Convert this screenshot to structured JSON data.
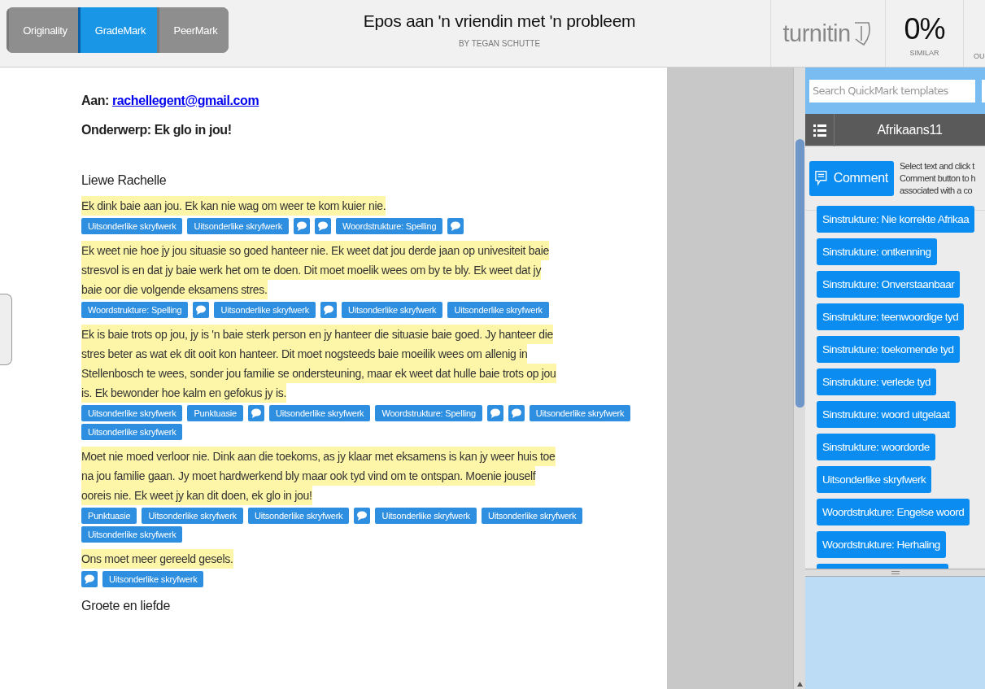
{
  "tabs": [
    {
      "label": "Originality",
      "selected": false
    },
    {
      "label": "GradeMark",
      "selected": true
    },
    {
      "label": "PeerMark",
      "selected": false
    }
  ],
  "paper": {
    "title": "Epos aan 'n vriendin met 'n probleem",
    "author": "BY TEGAN SCHUTTE"
  },
  "brand": "turnitin",
  "similarity": {
    "value": "0%",
    "label": "SIMILAR",
    "next_label": "OU"
  },
  "document": {
    "to_label": "Aan:",
    "to_email": "rachellegent@gmail.com",
    "subject": "Onderwerp: Ek glo in jou!",
    "greeting": "Liewe Rachelle",
    "paragraphs": [
      {
        "lines": [
          "Ek dink baie aan jou. Ek kan nie wag om weer te kom kuier nie."
        ],
        "marks": [
          {
            "kind": "label",
            "text": "Uitsonderlike skryfwerk"
          },
          {
            "kind": "label",
            "text": "Uitsonderlike skryfwerk"
          },
          {
            "kind": "comment"
          },
          {
            "kind": "comment"
          },
          {
            "kind": "label",
            "text": "Woordstrukture: Spelling"
          },
          {
            "kind": "comment"
          }
        ]
      },
      {
        "lines": [
          "Ek weet nie hoe jy jou situasie so goed hanteer nie. Ek weet dat jou derde jaan op univesiteit baie",
          "stresvol is en dat jy baie werk het om te doen. Dit moet moelik wees om by te bly. Ek weet dat jy",
          "baie oor die volgende eksamens stres."
        ],
        "marks": [
          {
            "kind": "label",
            "text": "Woordstrukture: Spelling"
          },
          {
            "kind": "comment"
          },
          {
            "kind": "label",
            "text": "Uitsonderlike skryfwerk"
          },
          {
            "kind": "comment"
          },
          {
            "kind": "label",
            "text": "Uitsonderlike skryfwerk"
          },
          {
            "kind": "label",
            "text": "Uitsonderlike skryfwerk"
          }
        ]
      },
      {
        "lines": [
          "Ek is baie trots op jou, jy is 'n baie sterk person en jy hanteer die situasie baie goed. Jy hanteer die",
          "stres beter as wat ek dit ooit kon hanteer. Dit moet nogsteeds baie moeilik wees om allenig in",
          "Stellenbosch te wees, sonder jou familie se ondersteuning, maar ek weet dat hulle baie trots op jou",
          "is. Ek bewonder hoe kalm en gefokus jy is."
        ],
        "marks": [
          {
            "kind": "label",
            "text": "Uitsonderlike skryfwerk"
          },
          {
            "kind": "label",
            "text": "Punktuasie"
          },
          {
            "kind": "comment"
          },
          {
            "kind": "label",
            "text": "Uitsonderlike skryfwerk"
          },
          {
            "kind": "label",
            "text": "Woordstrukture: Spelling"
          },
          {
            "kind": "comment"
          },
          {
            "kind": "comment"
          },
          {
            "kind": "label",
            "text": "Uitsonderlike skryfwerk"
          },
          {
            "kind": "label",
            "text": "Uitsonderlike skryfwerk"
          }
        ]
      },
      {
        "lines": [
          "Moet nie moed verloor nie. Dink aan die toekoms, as jy klaar met eksamens is kan jy weer huis toe",
          "na jou familie gaan. Jy moet hardwerkend bly maar ook tyd vind om te ontspan. Moenie jouself",
          "ooreis nie. Ek weet jy kan dit doen, ek glo in jou!"
        ],
        "marks": [
          {
            "kind": "label",
            "text": "Punktuasie"
          },
          {
            "kind": "label",
            "text": "Uitsonderlike skryfwerk"
          },
          {
            "kind": "label",
            "text": "Uitsonderlike skryfwerk"
          },
          {
            "kind": "comment"
          },
          {
            "kind": "label",
            "text": "Uitsonderlike skryfwerk"
          },
          {
            "kind": "label",
            "text": "Uitsonderlike skryfwerk"
          },
          {
            "kind": "label",
            "text": "Uitsonderlike skryfwerk"
          }
        ]
      },
      {
        "lines": [
          "Ons moet meer gereeld gesels."
        ],
        "marks": [
          {
            "kind": "comment"
          },
          {
            "kind": "label",
            "text": "Uitsonderlike skryfwerk"
          }
        ]
      }
    ],
    "closing": "Groete en liefde"
  },
  "panel": {
    "search_placeholder": "Search QuickMark templates",
    "set_name": "Afrikaans11",
    "comment_button": "Comment",
    "help_lines": [
      "Select text and click t",
      "Comment button to h",
      "associated with a co"
    ],
    "quickmarks": [
      "Sinstrukture: Nie korrekte Afrikaa",
      "Sinstrukture: ontkenning",
      "Sinstrukture: Onverstaanbaar",
      "Sinstrukture: teenwoordige tyd",
      "Sinstrukture: toekomende tyd",
      "Sinstrukture: verlede tyd",
      "Sinstrukture: woord uitgelaat",
      "Sinstrukture: woordorde",
      "Uitsonderlike skryfwerk",
      "Woordstrukture: Engelse woord",
      "Woordstrukture: Herhaling"
    ]
  }
}
